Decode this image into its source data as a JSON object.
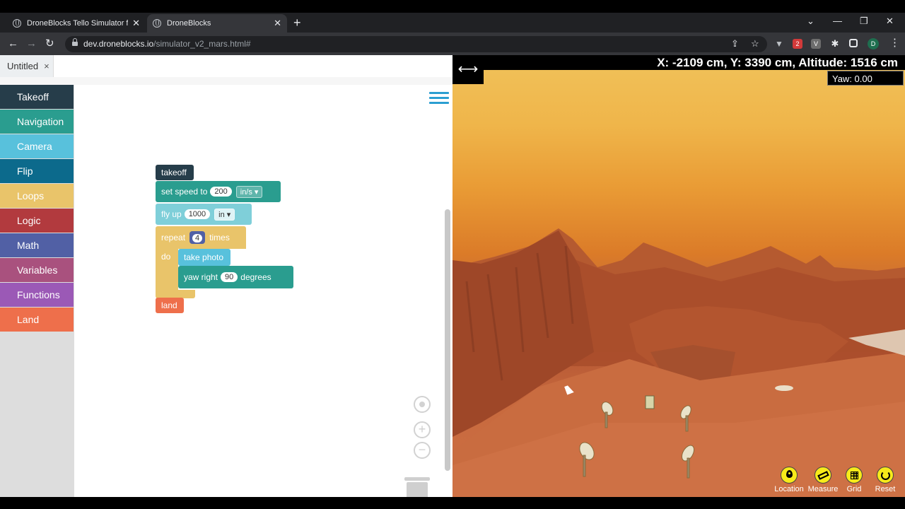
{
  "browser": {
    "tabs": [
      {
        "title": "DroneBlocks Tello Simulator for D",
        "close": "✕"
      },
      {
        "title": "DroneBlocks",
        "close": "✕"
      }
    ],
    "new_tab": "+",
    "window_controls": {
      "tab_search": "⌄",
      "minimize": "—",
      "restore": "❐",
      "close": "✕"
    },
    "nav": {
      "back": "←",
      "forward": "→",
      "reload": "↻"
    },
    "url": {
      "host": "dev.droneblocks.io",
      "path": "/simulator_v2_mars.html#"
    },
    "ext_badge": "2",
    "ext_v": "V",
    "profile": "D",
    "menu": "⋮"
  },
  "file_tab": {
    "label": "Untitled",
    "close": "×"
  },
  "toolbox": {
    "categories": [
      {
        "label": "Takeoff",
        "color": "#263d4a"
      },
      {
        "label": "Navigation",
        "color": "#2a9d8f"
      },
      {
        "label": "Camera",
        "color": "#58c1dc"
      },
      {
        "label": "Flip",
        "color": "#0c6a8c"
      },
      {
        "label": "Loops",
        "color": "#e9c46a"
      },
      {
        "label": "Logic",
        "color": "#b23a3e"
      },
      {
        "label": "Math",
        "color": "#5160a5"
      },
      {
        "label": "Variables",
        "color": "#a9517e"
      },
      {
        "label": "Functions",
        "color": "#9b59b6"
      },
      {
        "label": "Land",
        "color": "#ee6f4b"
      }
    ]
  },
  "blocks": {
    "takeoff": "takeoff",
    "set_speed": {
      "label": "set speed to",
      "value": "200",
      "unit": "in/s ▾"
    },
    "fly_up": {
      "label": "fly up",
      "value": "1000",
      "unit": "in ▾"
    },
    "repeat": {
      "label": "repeat",
      "value": "4",
      "suffix": "times",
      "do": "do"
    },
    "take_photo": "take photo",
    "yaw_right": {
      "label": "yaw right",
      "value": "90",
      "unit": "degrees"
    },
    "land": "land"
  },
  "workspace_controls": {
    "zoom_in": "+",
    "zoom_out": "−"
  },
  "simulator": {
    "coords": "X: -2109 cm, Y: 3390 cm, Altitude: 1516 cm",
    "yaw": "Yaw: 0.00",
    "expand": "⟷",
    "controls": [
      {
        "label": "Location"
      },
      {
        "label": "Measure"
      },
      {
        "label": "Grid"
      },
      {
        "label": "Reset"
      }
    ]
  }
}
